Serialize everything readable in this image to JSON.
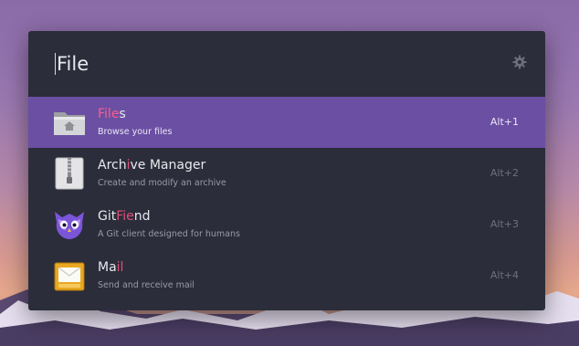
{
  "search": {
    "query": "File"
  },
  "results": [
    {
      "title_pre": "",
      "title_hl": "File",
      "title_post": "s",
      "description": "Browse your files",
      "shortcut": "Alt+1",
      "icon": "folder-home-icon",
      "selected": true
    },
    {
      "title_pre": "Arch",
      "title_hl": "i",
      "title_post": "ve Manager",
      "description": "Create and modify an archive",
      "shortcut": "Alt+2",
      "icon": "archive-zipper-icon",
      "selected": false
    },
    {
      "title_pre": "Git",
      "title_hl": "Fie",
      "title_post": "nd",
      "description": "A Git client designed for humans",
      "shortcut": "Alt+3",
      "icon": "gitfiend-owl-icon",
      "selected": false
    },
    {
      "title_pre": "Ma",
      "title_hl": "il",
      "title_post": "",
      "description": "Send and receive mail",
      "shortcut": "Alt+4",
      "icon": "mail-envelope-icon",
      "selected": false
    }
  ],
  "colors": {
    "panel": "#2b2d3a",
    "selection": "#6a4fa3",
    "match_highlight": "#e0507a"
  }
}
